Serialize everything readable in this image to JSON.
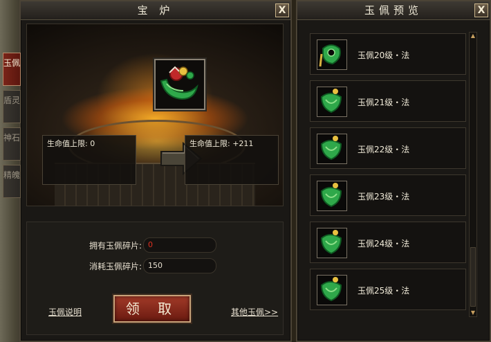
{
  "left_panel": {
    "title": "宝 炉",
    "close_label": "X",
    "tabs": [
      {
        "label": "玉佩",
        "active": true
      },
      {
        "label": "盾灵",
        "active": false
      },
      {
        "label": "神石",
        "active": false
      },
      {
        "label": "精魄",
        "active": false
      }
    ],
    "current_stat": "生命值上限: 0",
    "next_stat": "生命值上限: +211",
    "owned_label": "拥有玉佩碎片:",
    "owned_value": "0",
    "cost_label": "消耗玉佩碎片:",
    "cost_value": "150",
    "claim_button": "领 取",
    "help_link": "玉佩说明",
    "other_link": "其他玉佩>>"
  },
  "right_panel": {
    "title": "玉佩预览",
    "close_label": "X",
    "items": [
      {
        "label": "玉佩20级・法",
        "icon": "jade-pendant-icon"
      },
      {
        "label": "玉佩21级・法",
        "icon": "jade-pendant-icon"
      },
      {
        "label": "玉佩22级・法",
        "icon": "jade-pendant-icon"
      },
      {
        "label": "玉佩23级・法",
        "icon": "jade-pendant-icon"
      },
      {
        "label": "玉佩24级・法",
        "icon": "jade-pendant-icon"
      },
      {
        "label": "玉佩25级・法",
        "icon": "jade-pendant-icon"
      }
    ]
  },
  "colors": {
    "accent_red": "#7a2418",
    "jade_green": "#2fa84a",
    "owned_value_color": "#e03020"
  }
}
